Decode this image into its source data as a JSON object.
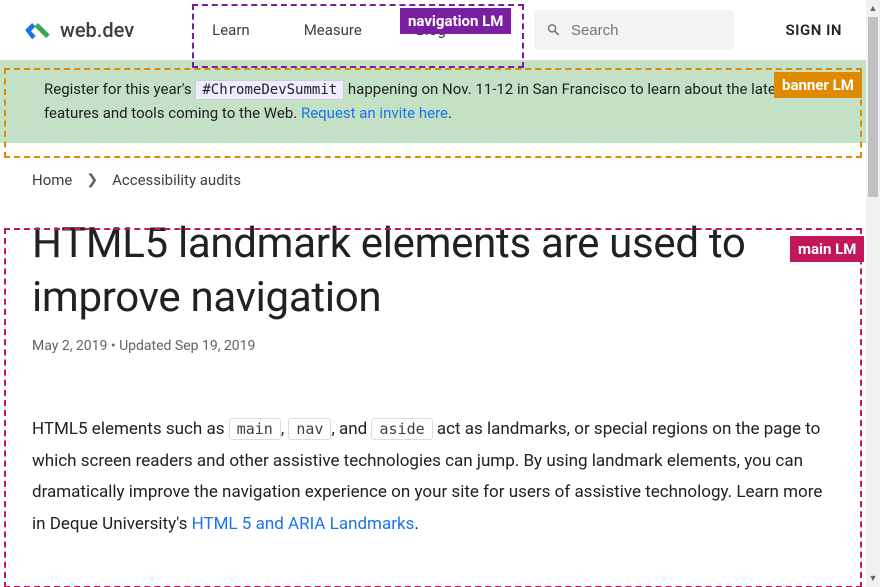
{
  "header": {
    "site_name": "web.dev",
    "nav": [
      "Learn",
      "Measure",
      "Blog"
    ],
    "search_placeholder": "Search",
    "signin": "SIGN IN"
  },
  "landmarks": {
    "nav_label": "navigation LM",
    "banner_label": "banner LM",
    "main_label": "main LM"
  },
  "banner": {
    "pre": "Register for this year's ",
    "hashtag": "#ChromeDevSummit",
    "mid": " happening on Nov. 11-12 in San Francisco to learn about the latest features and tools coming to the Web. ",
    "link_text": "Request an invite here",
    "post": "."
  },
  "breadcrumb": {
    "home": "Home",
    "section": "Accessibility audits"
  },
  "article": {
    "title": "HTML5 landmark elements are used to improve navigation",
    "date_published": "May 2, 2019",
    "date_separator": "  •  Updated ",
    "date_updated": "Sep 19, 2019",
    "p1_a": "HTML5 elements such as ",
    "code1": "main",
    "p1_b": ", ",
    "code2": "nav",
    "p1_c": ", and ",
    "code3": "aside",
    "p1_d": " act as landmarks, or special regions on the page to which screen readers and other assistive technologies can jump. By using landmark elements, you can dramatically improve the navigation experience on your site for users of assistive technology. Learn more in Deque University's ",
    "p1_link": "HTML 5 and ARIA Landmarks",
    "p1_e": "."
  }
}
